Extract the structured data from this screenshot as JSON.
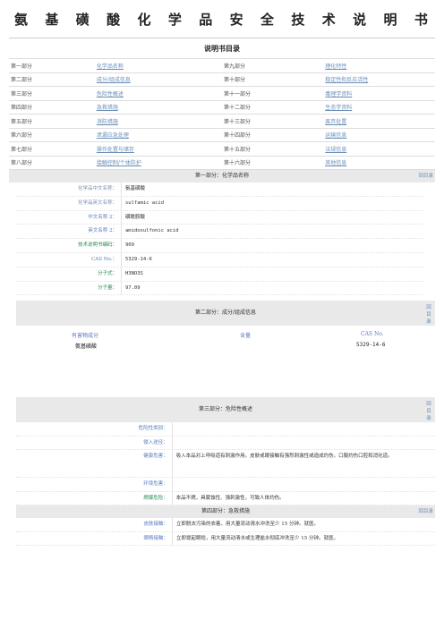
{
  "title_chars": [
    "氨",
    "基",
    "磺",
    "酸",
    "化",
    "学",
    "品",
    "安",
    "全",
    "技",
    "术",
    "说",
    "明",
    "书"
  ],
  "subtitle": "说明书目录",
  "toc": [
    [
      "第一部分",
      "化学品名称",
      "第九部分",
      "理化特性"
    ],
    [
      "第二部分",
      "成分/组成信息",
      "第十部分",
      "稳定性和反应活性"
    ],
    [
      "第三部分",
      "危险性概述",
      "第十一部分",
      "毒理学资料"
    ],
    [
      "第四部分",
      "急救措施",
      "第十二部分",
      "生态学资料"
    ],
    [
      "第五部分",
      "消防措施",
      "第十三部分",
      "废弃处置"
    ],
    [
      "第六部分",
      "泄漏应急处理",
      "第十四部分",
      "运输信息"
    ],
    [
      "第七部分",
      "操作处置与储存",
      "第十五部分",
      "法规信息"
    ],
    [
      "第八部分",
      "接触控制/个体防护",
      "第十六部分",
      "其他信息"
    ]
  ],
  "back": "回目录",
  "s1": {
    "title": "第一部分：化学品名称",
    "rows": [
      {
        "k": "化学品中文名称：",
        "v": "氨基磺酸"
      },
      {
        "k": "化学品英文名称：",
        "v": "sulfamic acid"
      },
      {
        "k": "中文名称 2：",
        "v": "磺酰胺酸"
      },
      {
        "k": "英文名称 2：",
        "v": "amidosulfonic acid"
      },
      {
        "k": "技术说明书编码：",
        "v": "909"
      },
      {
        "k": "CAS No.：",
        "v": "5329-14-6"
      },
      {
        "k": "分子式：",
        "v": "H3NO3S"
      },
      {
        "k": "分子量：",
        "v": "97.09"
      }
    ]
  },
  "s2": {
    "title": "第二部分：成分/组成信息",
    "headers": [
      "有害物成分",
      "含量",
      "CAS No."
    ],
    "row": [
      "氨基磺酸",
      "",
      "5329-14-6"
    ]
  },
  "s3": {
    "title": "第三部分：危险性概述",
    "rows": [
      {
        "k": "危险性类别：",
        "v": ""
      },
      {
        "k": "侵入途径：",
        "v": ""
      },
      {
        "k": "健康危害：",
        "v": "吸入本品对上呼吸道有刺激作用。皮肤或眼接触有强烈刺激性或造成灼伤。口服灼伤口腔和消化道。"
      },
      {
        "k": "环境危害：",
        "v": ""
      },
      {
        "k": "燃爆危险：",
        "v": "本品不燃，具腐蚀性、强刺激性，可致人体灼伤。"
      }
    ]
  },
  "s4": {
    "title": "第四部分：急救措施",
    "rows": [
      {
        "k": "皮肤接触：",
        "v": "立即脱去污染的衣着，用大量流动清水冲洗至少 15 分钟。就医。"
      },
      {
        "k": "眼睛接触：",
        "v": "立即提起眼睑，用大量流动清水或生理盐水彻底冲洗至少 15 分钟。就医。"
      }
    ]
  }
}
